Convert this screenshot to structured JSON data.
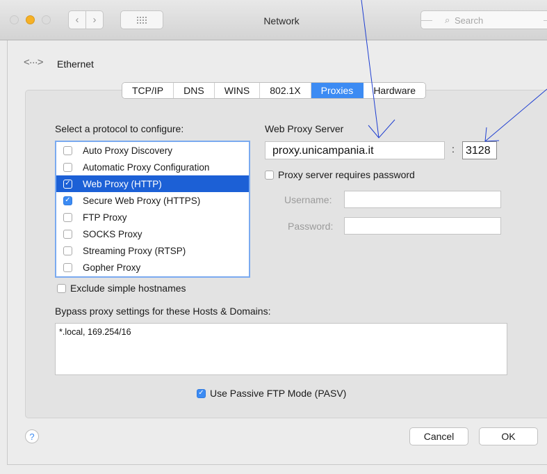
{
  "window": {
    "title": "Network"
  },
  "search": {
    "placeholder": "Search"
  },
  "service": {
    "name": "Ethernet"
  },
  "tabs": [
    {
      "label": "TCP/IP"
    },
    {
      "label": "DNS"
    },
    {
      "label": "WINS"
    },
    {
      "label": "802.1X"
    },
    {
      "label": "Proxies",
      "active": true
    },
    {
      "label": "Hardware"
    }
  ],
  "protocols": {
    "heading": "Select a protocol to configure:",
    "items": [
      {
        "label": "Auto Proxy Discovery",
        "checked": false
      },
      {
        "label": "Automatic Proxy Configuration",
        "checked": false
      },
      {
        "label": "Web Proxy (HTTP)",
        "checked": true,
        "selected": true
      },
      {
        "label": "Secure Web Proxy (HTTPS)",
        "checked": true
      },
      {
        "label": "FTP Proxy",
        "checked": false
      },
      {
        "label": "SOCKS Proxy",
        "checked": false
      },
      {
        "label": "Streaming Proxy (RTSP)",
        "checked": false
      },
      {
        "label": "Gopher Proxy",
        "checked": false
      }
    ]
  },
  "proxy_server": {
    "heading": "Web Proxy Server",
    "host": "proxy.unicampania.it",
    "separator": ":",
    "port": "3128",
    "requires_password_label": "Proxy server requires password",
    "requires_password": false,
    "username_label": "Username:",
    "username": "",
    "password_label": "Password:",
    "password": ""
  },
  "exclude_simple": {
    "label": "Exclude simple hostnames",
    "checked": false
  },
  "bypass": {
    "heading": "Bypass proxy settings for these Hosts & Domains:",
    "value": "*.local, 169.254/16"
  },
  "pasv": {
    "label": "Use Passive FTP Mode (PASV)",
    "checked": true
  },
  "buttons": {
    "help": "?",
    "cancel": "Cancel",
    "ok": "OK"
  },
  "colors": {
    "accent": "#3c8bf3",
    "selection": "#1c60d6"
  }
}
